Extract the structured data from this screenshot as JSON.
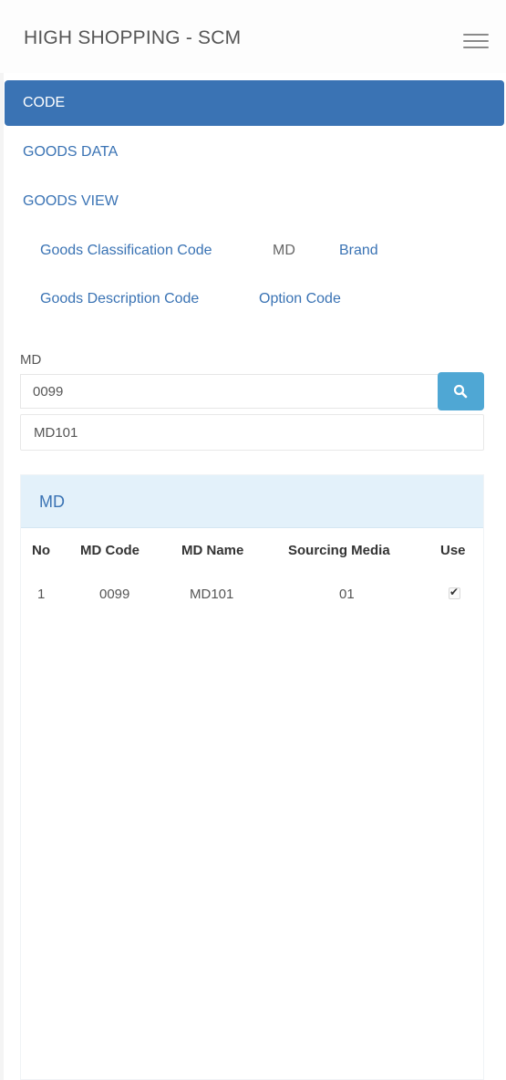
{
  "header": {
    "title": "HIGH SHOPPING - SCM",
    "menu_icon": "hamburger-icon"
  },
  "nav": {
    "items": [
      {
        "label": "CODE",
        "active": true
      },
      {
        "label": "GOODS DATA",
        "active": false
      },
      {
        "label": "GOODS VIEW",
        "active": false
      }
    ],
    "sub_items": [
      {
        "label": "Goods Classification Code",
        "active": false
      },
      {
        "label": "MD",
        "active": true
      },
      {
        "label": "Brand",
        "active": false
      },
      {
        "label": "Goods Description Code",
        "active": false
      },
      {
        "label": "Option Code",
        "active": false
      }
    ]
  },
  "form": {
    "label": "MD",
    "md_code_value": "0099",
    "md_name_value": "MD101",
    "search_icon": "search-icon"
  },
  "panel": {
    "title": "MD",
    "columns": [
      "No",
      "MD Code",
      "MD Name",
      "Sourcing Media",
      "Use"
    ],
    "rows": [
      {
        "no": "1",
        "md_code": "0099",
        "md_name": "MD101",
        "sourcing_media": "01",
        "use": true
      }
    ]
  },
  "colors": {
    "primary": "#3a73b4",
    "search_button": "#4fa7d4",
    "panel_heading_bg": "#e3f1fa"
  }
}
